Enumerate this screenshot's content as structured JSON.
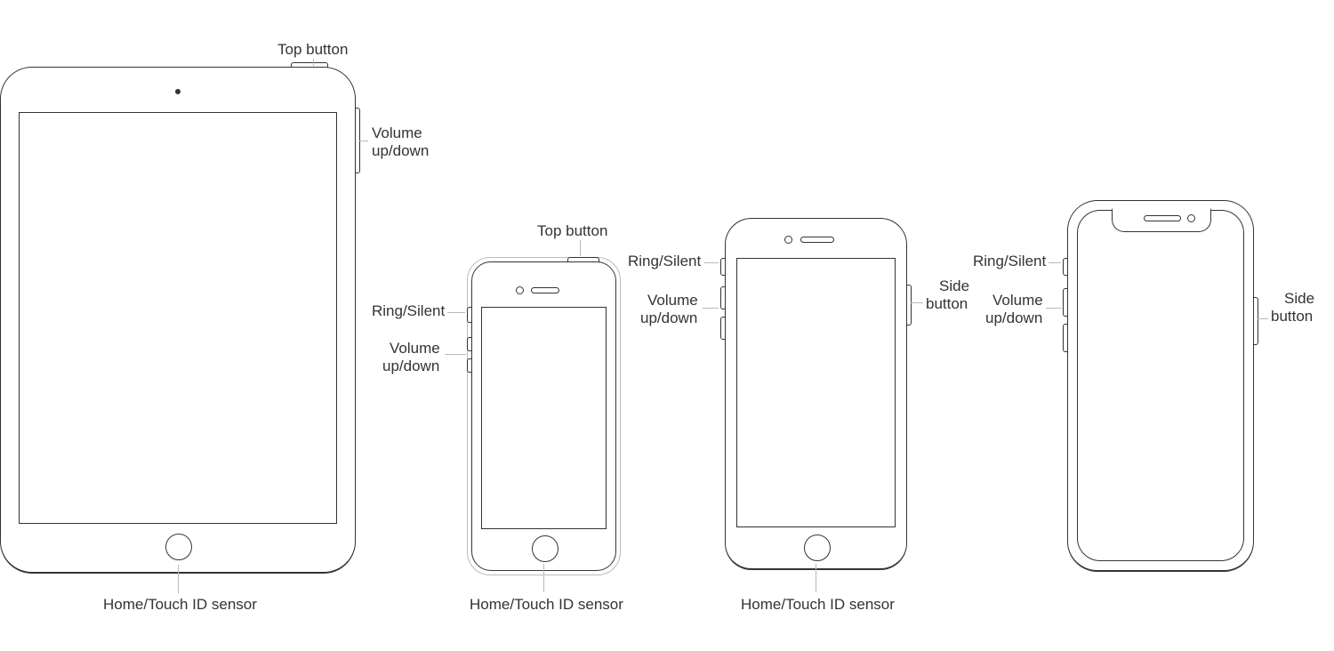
{
  "labels": {
    "top_button": "Top button",
    "volume": "Volume",
    "up_down": "up/down",
    "ring_silent": "Ring/Silent",
    "side": "Side",
    "button": "button",
    "home_sensor": "Home/Touch ID sensor"
  },
  "devices": [
    {
      "id": "ipad",
      "type": "tablet",
      "features": [
        "top-button",
        "volume-up-down",
        "home-touch-id-sensor",
        "front-camera"
      ]
    },
    {
      "id": "iphone-small",
      "type": "phone",
      "features": [
        "top-button",
        "ring-silent-switch",
        "volume-up-down",
        "home-touch-id-sensor",
        "speaker",
        "front-camera"
      ]
    },
    {
      "id": "iphone-home",
      "type": "phone",
      "features": [
        "ring-silent-switch",
        "volume-up-down",
        "side-button",
        "home-touch-id-sensor",
        "speaker",
        "front-camera"
      ]
    },
    {
      "id": "iphone-notch",
      "type": "phone",
      "features": [
        "ring-silent-switch",
        "volume-up-down",
        "side-button",
        "notch",
        "speaker",
        "front-camera"
      ]
    }
  ]
}
